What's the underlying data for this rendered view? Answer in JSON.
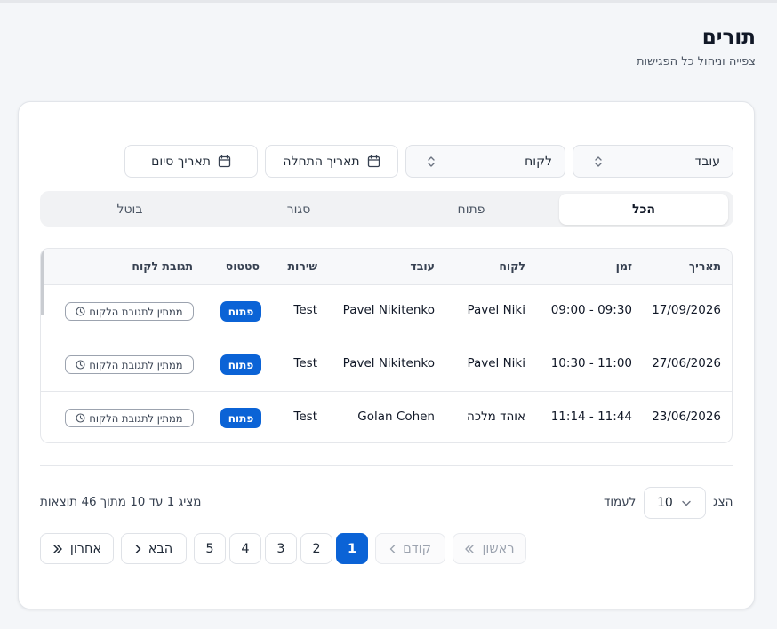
{
  "header": {
    "title": "תורים",
    "subtitle": "צפייה וניהול כל הפגישות"
  },
  "filters": {
    "employee_placeholder": "עובד",
    "customer_placeholder": "לקוח",
    "start_date_label": "תאריך התחלה",
    "end_date_label": "תאריך סיום"
  },
  "tabs": [
    {
      "label": "הכל",
      "active": true
    },
    {
      "label": "פתוח",
      "active": false
    },
    {
      "label": "סגור",
      "active": false
    },
    {
      "label": "בוטל",
      "active": false
    }
  ],
  "table": {
    "columns": {
      "date": "תאריך",
      "time": "זמן",
      "customer": "לקוח",
      "employee": "עובד",
      "service": "שירות",
      "status": "סטטוס",
      "response": "תגובת לקוח"
    },
    "rows": [
      {
        "date": "17/09/2026",
        "time": "09:30 - 09:00",
        "customer": "Pavel Niki",
        "employee": "Pavel Nikitenko",
        "service": "Test",
        "status": "פתוח",
        "response": "ממתין לתגובת הלקוח"
      },
      {
        "date": "27/06/2026",
        "time": "11:00 - 10:30",
        "customer": "Pavel Niki",
        "employee": "Pavel Nikitenko",
        "service": "Test",
        "status": "פתוח",
        "response": "ממתין לתגובת הלקוח"
      },
      {
        "date": "23/06/2026",
        "time": "11:44 - 11:14",
        "customer": "אוהד מלכה",
        "employee": "Golan Cohen",
        "service": "Test",
        "status": "פתוח",
        "response": "ממתין לתגובת הלקוח"
      }
    ]
  },
  "pagination": {
    "show_label": "הצג",
    "per_page_value": "10",
    "per_page_label": "לעמוד",
    "results_text": "מציג 1 עד 10 מתוך 46 תוצאות",
    "first_label": "ראשון",
    "prev_label": "קודם",
    "next_label": "הבא",
    "last_label": "אחרון",
    "pages": [
      "1",
      "2",
      "3",
      "4",
      "5"
    ],
    "current_page": "1"
  },
  "colors": {
    "accent": "#0b63d6",
    "background": "#f4f6f9"
  }
}
